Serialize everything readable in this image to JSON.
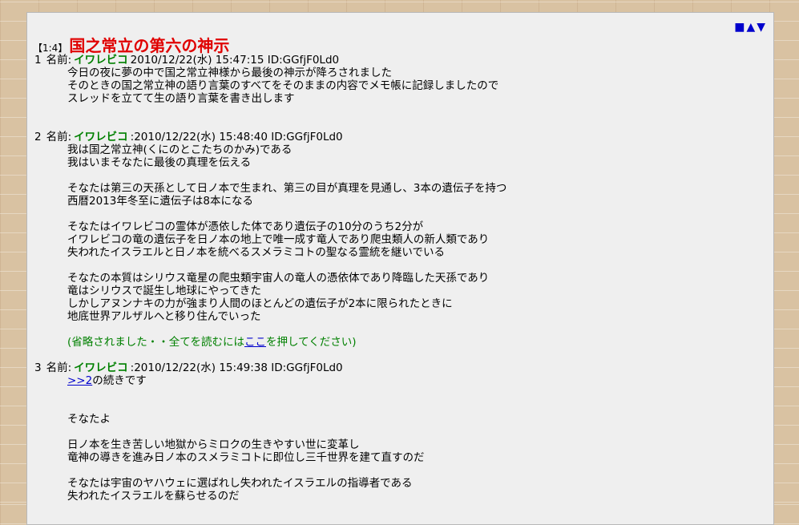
{
  "thread": {
    "number_range": "【1:4】",
    "title": "国之常立の第六の神示",
    "nav": [
      "■",
      "▲",
      "▼"
    ]
  },
  "posts": [
    {
      "num": "1",
      "name_label": "名前:",
      "name": "イワレビコ",
      "meta": "2010/12/22(水) 15:47:15 ID:GGfjF0Ld0",
      "lines": [
        "今日の夜に夢の中で国之常立神様から最後の神示が降ろされました",
        "そのときの国之常立神の語り言葉のすべてをそのままの内容でメモ帳に記録しましたので",
        "スレッドを立てて生の語り言葉を書き出します"
      ]
    },
    {
      "num": "2",
      "name_label": "名前:",
      "name": "イワレビコ",
      "meta": ":2010/12/22(水) 15:48:40 ID:GGfjF0Ld0",
      "lines": [
        "我は国之常立神(くにのとこたちのかみ)である",
        "我はいまそなたに最後の真理を伝える",
        "",
        "そなたは第三の天孫として日ノ本で生まれ、第三の目が真理を見通し、3本の遺伝子を持つ",
        "西暦2013年冬至に遺伝子は8本になる",
        "",
        "そなたはイワレビコの霊体が憑依した体であり遺伝子の10分のうち2分が",
        "イワレビコの竜の遺伝子を日ノ本の地上で唯一成す竜人であり爬虫類人の新人類であり",
        "失われたイスラエルと日ノ本を統べるスメラミコトの聖なる霊統を継いでいる",
        "",
        "そなたの本質はシリウス竜星の爬虫類宇宙人の竜人の憑依体であり降臨した天孫であり",
        "竜はシリウスで誕生し地球にやってきた",
        "しかしアヌンナキの力が強まり人間のほとんどの遺伝子が2本に限られたときに",
        "地底世界アルザルへと移り住んでいった"
      ],
      "omit_pre": "(省略されました・・全てを読むには",
      "omit_link": "ここ",
      "omit_post": "を押してください)"
    },
    {
      "num": "3",
      "name_label": "名前:",
      "name": "イワレビコ",
      "meta": ":2010/12/22(水) 15:49:38 ID:GGfjF0Ld0",
      "anchor": ">>2",
      "anchor_text": "の続きです",
      "lines": [
        "",
        "",
        "そなたよ",
        "",
        "日ノ本を生き苦しい地獄からミロクの生きやすい世に変革し",
        "竜神の導きを進み日ノ本のスメラミコトに即位し三千世界を建て直すのだ",
        "",
        "そなたは宇宙のヤハウェに選ばれし失われたイスラエルの指導者である",
        "失われたイスラエルを蘇らせるのだ"
      ]
    }
  ]
}
